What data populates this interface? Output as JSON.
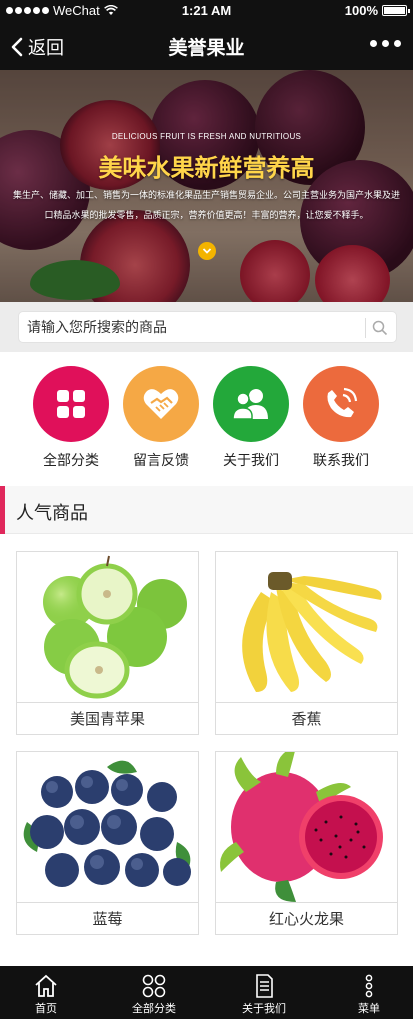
{
  "status_bar": {
    "carrier": "WeChat",
    "time": "1:21 AM",
    "battery": "100%",
    "battery_level": 1.0
  },
  "navbar": {
    "back_label": "返回",
    "title": "美誉果业"
  },
  "banner": {
    "subtitle_en": "DELICIOUS FRUIT IS FRESH AND NUTRITIOUS",
    "title": "美味水果新鲜营养高",
    "description": "集生产、储藏、加工、销售为一体的标准化果品生产销售贸易企业。公司主营业务为国产水果及进口精品水果的批发零售，品质正宗，营养价值更高！丰富的营养，让您爱不释手。"
  },
  "search": {
    "placeholder": "请输入您所搜索的商品"
  },
  "categories": [
    {
      "label": "全部分类",
      "icon": "grid-icon",
      "color": "#e0105a"
    },
    {
      "label": "留言反馈",
      "icon": "handshake-heart-icon",
      "color": "#f5a845"
    },
    {
      "label": "关于我们",
      "icon": "users-icon",
      "color": "#23a83a"
    },
    {
      "label": "联系我们",
      "icon": "phone-icon",
      "color": "#ec6a3d"
    }
  ],
  "section": {
    "title": "人气商品",
    "accent": "#e0285c"
  },
  "products": [
    {
      "name": "美国青苹果",
      "image": "green-apples"
    },
    {
      "name": "香蕉",
      "image": "bananas"
    },
    {
      "name": "蓝莓",
      "image": "blueberries"
    },
    {
      "name": "红心火龙果",
      "image": "red-dragon-fruit"
    }
  ],
  "tabbar": [
    {
      "label": "首页",
      "icon": "home-icon"
    },
    {
      "label": "全部分类",
      "icon": "grid-outline-icon"
    },
    {
      "label": "关于我们",
      "icon": "document-icon"
    },
    {
      "label": "菜单",
      "icon": "more-vertical-icon"
    }
  ]
}
